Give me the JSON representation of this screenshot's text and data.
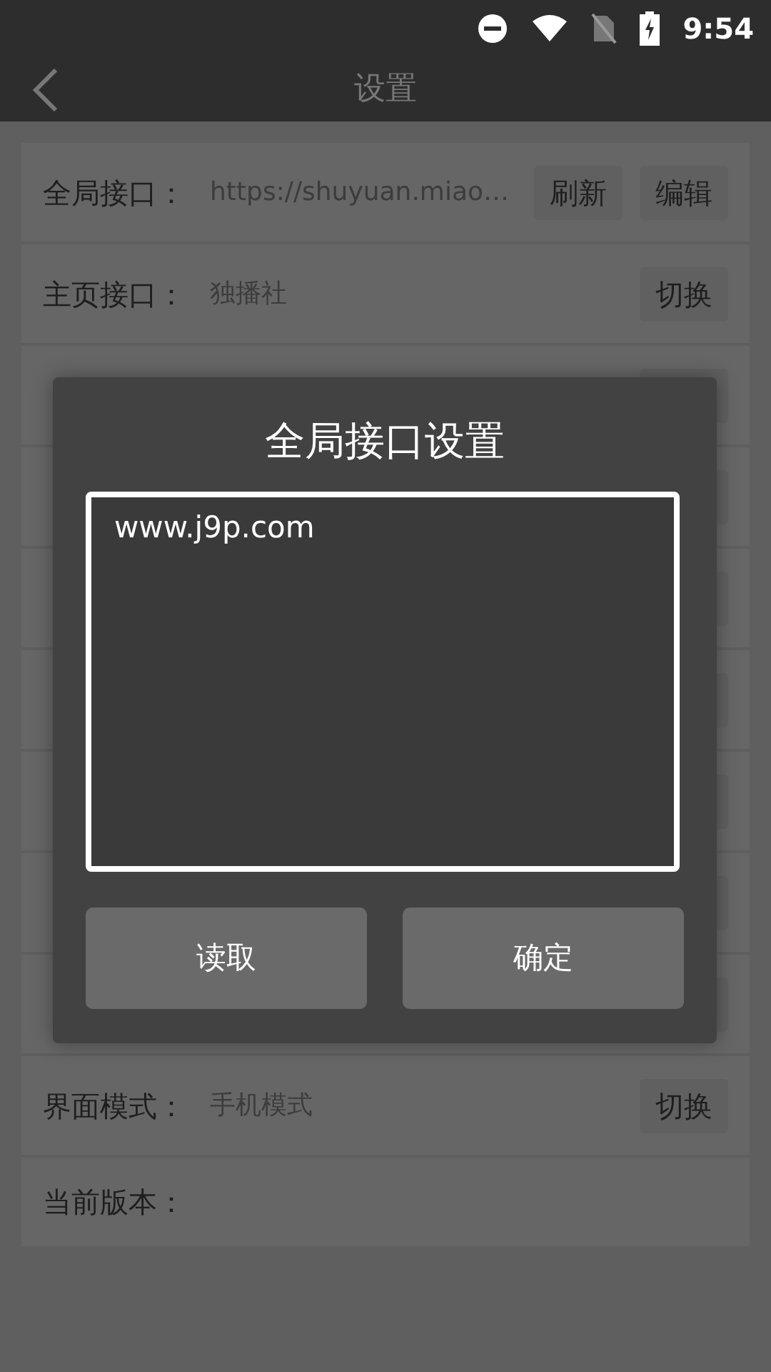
{
  "status_bar": {
    "time": "9:54"
  },
  "toolbar": {
    "title": "设置"
  },
  "settings": [
    {
      "kind": "row",
      "label": "全局接口：",
      "value": "https://shuyuan.miao…",
      "buttons": [
        "刷新",
        "编辑"
      ]
    },
    {
      "kind": "row",
      "label": "主页接口：",
      "value": "独播社",
      "buttons": [
        "切换"
      ]
    },
    {
      "kind": "covered"
    },
    {
      "kind": "covered"
    },
    {
      "kind": "covered"
    },
    {
      "kind": "covered"
    },
    {
      "kind": "covered"
    },
    {
      "kind": "covered"
    },
    {
      "kind": "covered"
    },
    {
      "kind": "row",
      "label": "界面模式：",
      "value": "手机模式",
      "buttons": [
        "切换"
      ]
    },
    {
      "kind": "row",
      "label": "当前版本："
    }
  ],
  "dialog": {
    "title": "全局接口设置",
    "field_value": "www.j9p.com",
    "buttons": [
      "读取",
      "确定"
    ]
  }
}
